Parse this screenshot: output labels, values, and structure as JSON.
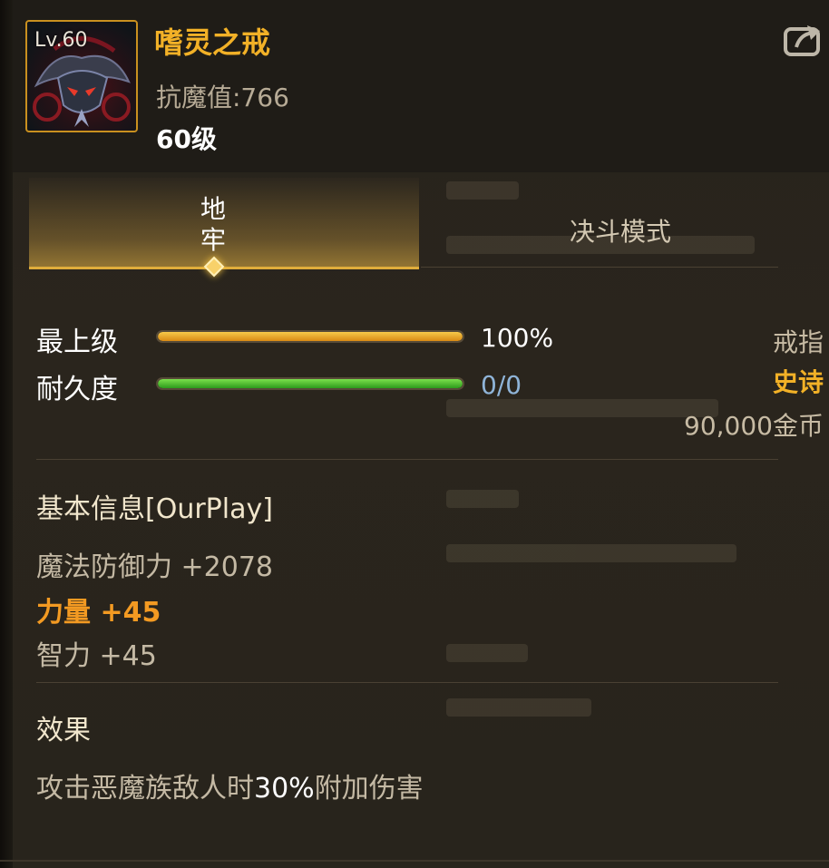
{
  "item": {
    "level_badge": "Lv.60",
    "name": "嗜灵之戒",
    "anti_magic": "抗魔值:766",
    "level": "60级",
    "icon": "demon-helmet-ring-icon"
  },
  "share_icon": "share-icon",
  "tabs": [
    {
      "label": "地牢",
      "active": true
    },
    {
      "label": "决斗模式",
      "active": false
    }
  ],
  "stats": {
    "top_level": {
      "label": "最上级",
      "value_text": "100%",
      "fraction": 1.0
    },
    "durability": {
      "label": "耐久度",
      "value_text": "0/0",
      "fraction": 1.0
    }
  },
  "meta": {
    "type": "戒指",
    "rarity": "史诗",
    "price": "90,000金币"
  },
  "basic_info": {
    "title": "基本信息[OurPlay]",
    "attributes": [
      {
        "text": "魔法防御力 +2078"
      },
      {
        "text": "力量 +45"
      },
      {
        "text": "智力 +45"
      }
    ]
  },
  "effect": {
    "title": "效果",
    "text_before": "攻击恶魔族敌人时",
    "highlight": "30%",
    "text_after": "附加伤害"
  },
  "colors": {
    "gold": "#f2b127",
    "orange": "#f39a22",
    "green_bar": "#4ec12c",
    "blue_value": "#8fb4d8"
  }
}
